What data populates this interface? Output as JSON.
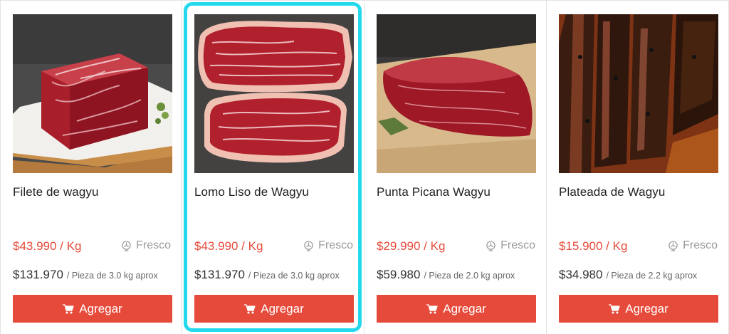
{
  "products": [
    {
      "name": "Filete de wagyu",
      "price_per_kg": "$43.990 / Kg",
      "freshness": "Fresco",
      "piece_price": "$131.970",
      "piece_note": "/ Pieza de 3.0 kg aprox",
      "button_label": "Agregar",
      "image_icon": "wagyu-fillet-image",
      "selected": false
    },
    {
      "name": "Lomo Liso de Wagyu",
      "price_per_kg": "$43.990 / Kg",
      "freshness": "Fresco",
      "piece_price": "$131.970",
      "piece_note": "/ Pieza de 3.0 kg aprox",
      "button_label": "Agregar",
      "image_icon": "wagyu-striploin-image",
      "selected": true
    },
    {
      "name": "Punta Picana Wagyu",
      "price_per_kg": "$29.990 / Kg",
      "freshness": "Fresco",
      "piece_price": "$59.980",
      "piece_note": "/ Pieza de 2.0 kg aprox",
      "button_label": "Agregar",
      "image_icon": "wagyu-picanha-image",
      "selected": false
    },
    {
      "name": "Plateada de Wagyu",
      "price_per_kg": "$15.900 / Kg",
      "freshness": "Fresco",
      "piece_price": "$34.980",
      "piece_note": "/ Pieza de 2.2 kg aprox",
      "button_label": "Agregar",
      "image_icon": "wagyu-plateada-image",
      "selected": false
    }
  ],
  "colors": {
    "accent": "#e64a3a",
    "selection": "#25d9ec",
    "muted": "#9b9b9b"
  },
  "icons": {
    "fresh": "fan-icon",
    "cart": "cart-icon"
  }
}
